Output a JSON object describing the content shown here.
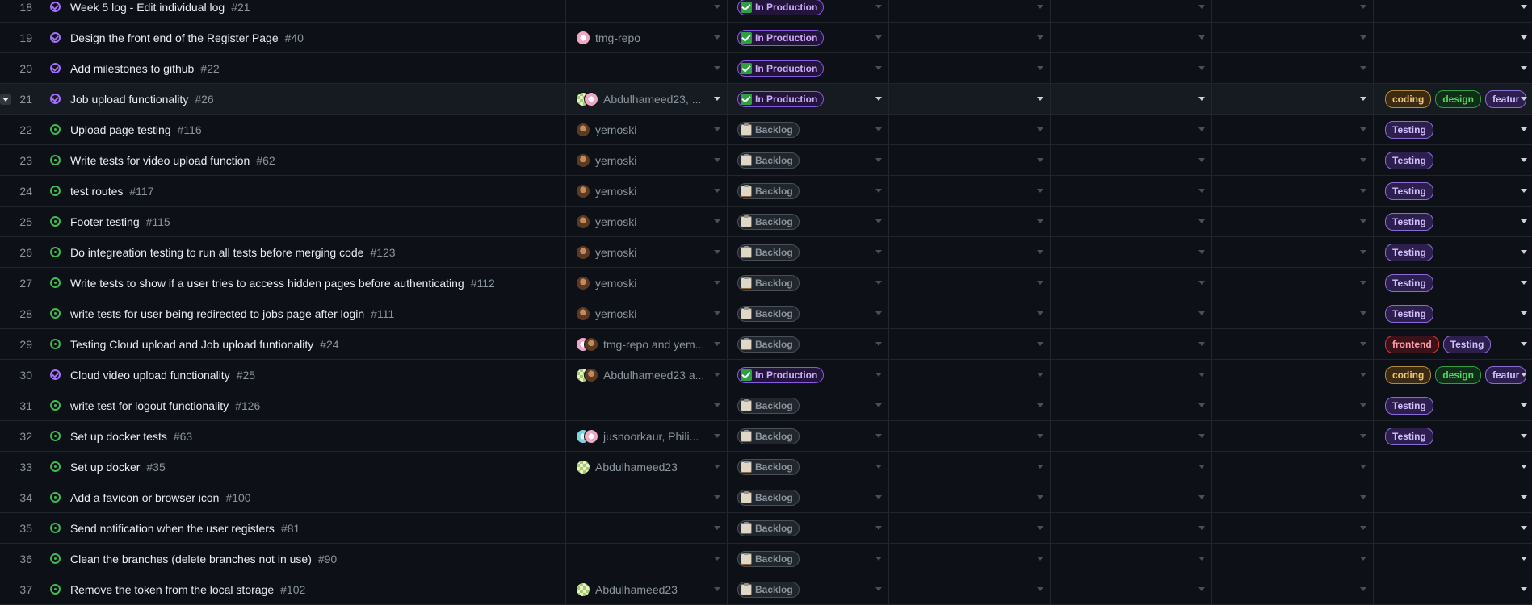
{
  "rows": [
    {
      "num": "18",
      "state": "closed",
      "title": "Week 5 log - Edit individual log",
      "issue": "#21",
      "avatars": [],
      "assignees": "",
      "status": "prod",
      "status_label": "In Production",
      "labels": []
    },
    {
      "num": "19",
      "state": "closed",
      "title": "Design the front end of the Register Page",
      "issue": "#40",
      "avatars": [
        "tmg"
      ],
      "assignees": "tmg-repo",
      "status": "prod",
      "status_label": "In Production",
      "labels": []
    },
    {
      "num": "20",
      "state": "closed",
      "title": "Add milestones to github",
      "issue": "#22",
      "avatars": [],
      "assignees": "",
      "status": "prod",
      "status_label": "In Production",
      "labels": []
    },
    {
      "num": "21",
      "state": "closed",
      "title": "Job upload functionality",
      "issue": "#26",
      "avatars": [
        "abd",
        "tmg"
      ],
      "assignees": "Abdulhameed23, ...",
      "status": "prod",
      "status_label": "In Production",
      "labels": [
        {
          "t": "coding",
          "c": "coding"
        },
        {
          "t": "design",
          "c": "design"
        },
        {
          "t": "featur",
          "c": "feature"
        }
      ],
      "highlight": true
    },
    {
      "num": "22",
      "state": "open",
      "title": "Upload page testing",
      "issue": "#116",
      "avatars": [
        "yem"
      ],
      "assignees": "yemoski",
      "status": "back",
      "status_label": "Backlog",
      "labels": [
        {
          "t": "Testing",
          "c": "testing"
        }
      ]
    },
    {
      "num": "23",
      "state": "open",
      "title": "Write tests for video upload function",
      "issue": "#62",
      "avatars": [
        "yem"
      ],
      "assignees": "yemoski",
      "status": "back",
      "status_label": "Backlog",
      "labels": [
        {
          "t": "Testing",
          "c": "testing"
        }
      ]
    },
    {
      "num": "24",
      "state": "open",
      "title": "test routes",
      "issue": "#117",
      "avatars": [
        "yem"
      ],
      "assignees": "yemoski",
      "status": "back",
      "status_label": "Backlog",
      "labels": [
        {
          "t": "Testing",
          "c": "testing"
        }
      ]
    },
    {
      "num": "25",
      "state": "open",
      "title": "Footer testing",
      "issue": "#115",
      "avatars": [
        "yem"
      ],
      "assignees": "yemoski",
      "status": "back",
      "status_label": "Backlog",
      "labels": [
        {
          "t": "Testing",
          "c": "testing"
        }
      ]
    },
    {
      "num": "26",
      "state": "open",
      "title": "Do integreation testing to run all tests before merging code",
      "issue": "#123",
      "avatars": [
        "yem"
      ],
      "assignees": "yemoski",
      "status": "back",
      "status_label": "Backlog",
      "labels": [
        {
          "t": "Testing",
          "c": "testing"
        }
      ]
    },
    {
      "num": "27",
      "state": "open",
      "title": "Write tests to show if a user tries to access hidden pages before authenticating",
      "issue": "#112",
      "avatars": [
        "yem"
      ],
      "assignees": "yemoski",
      "status": "back",
      "status_label": "Backlog",
      "labels": [
        {
          "t": "Testing",
          "c": "testing"
        }
      ]
    },
    {
      "num": "28",
      "state": "open",
      "title": "write tests for user being redirected to jobs page after login",
      "issue": "#111",
      "avatars": [
        "yem"
      ],
      "assignees": "yemoski",
      "status": "back",
      "status_label": "Backlog",
      "labels": [
        {
          "t": "Testing",
          "c": "testing"
        }
      ]
    },
    {
      "num": "29",
      "state": "open",
      "title": "Testing Cloud upload and Job upload funtionality",
      "issue": "#24",
      "avatars": [
        "tmg",
        "yem"
      ],
      "assignees": "tmg-repo and yem...",
      "status": "back",
      "status_label": "Backlog",
      "labels": [
        {
          "t": "frontend",
          "c": "frontend"
        },
        {
          "t": "Testing",
          "c": "testing"
        }
      ]
    },
    {
      "num": "30",
      "state": "closed",
      "title": "Cloud video upload functionality",
      "issue": "#25",
      "avatars": [
        "abd",
        "yem"
      ],
      "assignees": "Abdulhameed23 a...",
      "status": "prod",
      "status_label": "In Production",
      "labels": [
        {
          "t": "coding",
          "c": "coding"
        },
        {
          "t": "design",
          "c": "design"
        },
        {
          "t": "featur",
          "c": "feature"
        }
      ]
    },
    {
      "num": "31",
      "state": "open",
      "title": "write test for logout functionality",
      "issue": "#126",
      "avatars": [],
      "assignees": "",
      "status": "back",
      "status_label": "Backlog",
      "labels": [
        {
          "t": "Testing",
          "c": "testing"
        }
      ]
    },
    {
      "num": "32",
      "state": "open",
      "title": "Set up docker tests",
      "issue": "#63",
      "avatars": [
        "jus",
        "tmg"
      ],
      "assignees": "jusnoorkaur, Phili...",
      "status": "back",
      "status_label": "Backlog",
      "labels": [
        {
          "t": "Testing",
          "c": "testing"
        }
      ]
    },
    {
      "num": "33",
      "state": "open",
      "title": "Set up docker",
      "issue": "#35",
      "avatars": [
        "abd"
      ],
      "assignees": "Abdulhameed23",
      "status": "back",
      "status_label": "Backlog",
      "labels": []
    },
    {
      "num": "34",
      "state": "open",
      "title": "Add a favicon or browser icon",
      "issue": "#100",
      "avatars": [],
      "assignees": "",
      "status": "back",
      "status_label": "Backlog",
      "labels": []
    },
    {
      "num": "35",
      "state": "open",
      "title": "Send notification when the user registers",
      "issue": "#81",
      "avatars": [],
      "assignees": "",
      "status": "back",
      "status_label": "Backlog",
      "labels": []
    },
    {
      "num": "36",
      "state": "open",
      "title": "Clean the branches (delete branches not in use)",
      "issue": "#90",
      "avatars": [],
      "assignees": "",
      "status": "back",
      "status_label": "Backlog",
      "labels": []
    },
    {
      "num": "37",
      "state": "open",
      "title": "Remove the token from the local storage",
      "issue": "#102",
      "avatars": [
        "abd"
      ],
      "assignees": "Abdulhameed23",
      "status": "back",
      "status_label": "Backlog",
      "labels": []
    }
  ],
  "colors": {
    "background": "#0d1117",
    "open_icon": "#3fb950",
    "closed_icon": "#a371f7",
    "in_production_border": "#8957e5"
  }
}
